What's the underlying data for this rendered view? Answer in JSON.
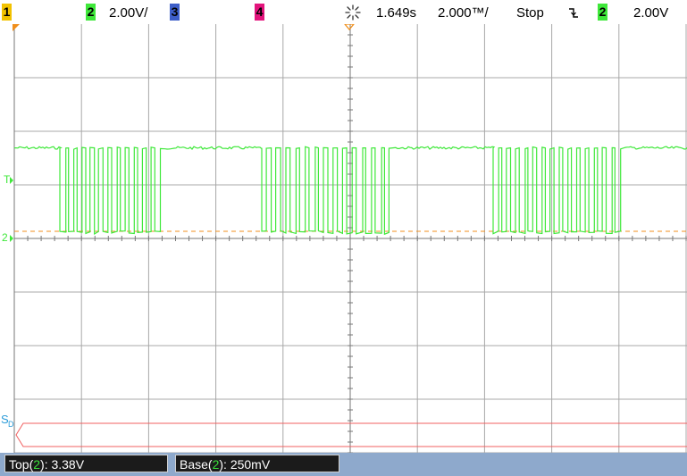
{
  "colors": {
    "ch1": "#f2c200",
    "ch2": "#3fe83a",
    "ch3": "#3d5ec8",
    "ch4": "#e3147c",
    "trigger_marker": "#f08f1c",
    "ref_trace": "#f06060",
    "grid": "#9a9a9a",
    "source_label": "#2a9bd8"
  },
  "status_bar": {
    "ch1_num": "1",
    "ch2_num": "2",
    "ch2_scale": "2.00V/",
    "ch3_num": "3",
    "ch4_num": "4",
    "trigger_icon": "trigger-burst-icon",
    "time_position": "1.649s",
    "time_scale": "2.000™/",
    "run_state": "Stop",
    "trigger_edge_icon": "falling-edge-icon",
    "trig_source_num": "2",
    "trig_level": "2.00V"
  },
  "screen": {
    "trigger_level_label": "T",
    "ch2_ground_label": "2",
    "serial_label": "S",
    "serial_sub": "D"
  },
  "measurements": {
    "top": {
      "prefix": "Top(",
      "channel": "2",
      "suffix": "): 3.38V"
    },
    "base": {
      "prefix": "Base(",
      "channel": "2",
      "suffix": "): 250mV"
    }
  },
  "waveform": {
    "high_level_v": 3.38,
    "low_level_v": 0.25,
    "bursts": [
      {
        "pulses": 12
      },
      {
        "pulses": 14
      },
      {
        "pulses": 15
      }
    ]
  }
}
